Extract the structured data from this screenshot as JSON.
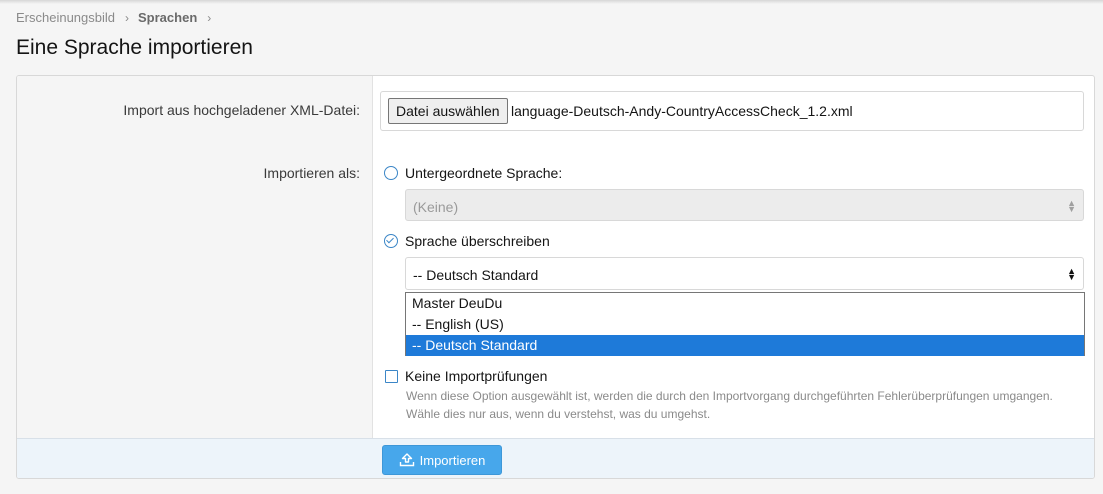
{
  "breadcrumb": {
    "items": [
      "Erscheinungsbild",
      "Sprachen"
    ],
    "separator": "›"
  },
  "page_title": "Eine Sprache importieren",
  "form": {
    "import_label": "Import aus hochgeladener XML-Datei:",
    "file_button": "Datei auswählen",
    "file_name": "language-Deutsch-Andy-CountryAccessCheck_1.2.xml",
    "import_as_label": "Importieren als:",
    "option_child": "Untergeordnete Sprache:",
    "child_select_value": "(Keine)",
    "option_overwrite": "Sprache überschreiben",
    "overwrite_select_value": "-- Deutsch Standard",
    "dropdown_options": [
      "Master DeuDu",
      "-- English (US)",
      "-- Deutsch Standard"
    ],
    "selected_option": "-- Deutsch Standard",
    "no_checks_label": "Keine Importprüfungen",
    "no_checks_hint": "Wenn diese Option ausgewählt ist, werden die durch den Importvorgang durchgeführten Fehlerüberprüfungen umgangen. Wähle dies nur aus, wenn du verstehst, was du umgehst."
  },
  "footer": {
    "submit_label": "Importieren"
  },
  "colors": {
    "accent": "#47a7eb",
    "selected": "#1e7ad9",
    "radio": "#3b86c7"
  },
  "icons": {
    "submit": "upload-icon",
    "breadcrumb_separator": "chevron-right-icon"
  }
}
